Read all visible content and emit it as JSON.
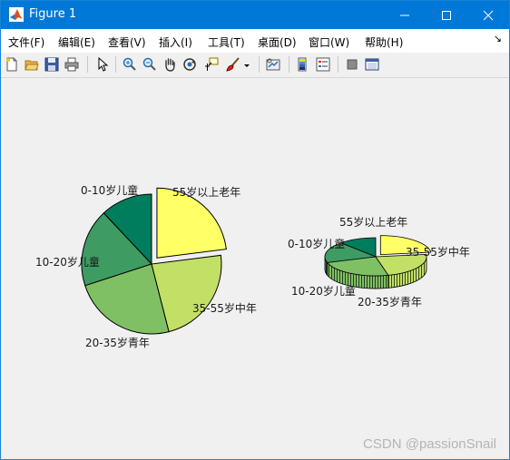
{
  "window": {
    "title": "Figure 1",
    "colors": {
      "titlebar": "#0078d7",
      "canvas": "#f0f0f0"
    }
  },
  "menubar": {
    "items": [
      "文件(F)",
      "编辑(E)",
      "查看(V)",
      "插入(I)",
      "工具(T)",
      "桌面(D)",
      "窗口(W)",
      "帮助(H)"
    ],
    "overflow_icon": "chevron-icon"
  },
  "toolbar": {
    "icons": [
      "new-figure-icon",
      "open-file-icon",
      "save-icon",
      "print-icon",
      "pointer-icon",
      "zoom-in-icon",
      "zoom-out-icon",
      "pan-hand-icon",
      "rotate-3d-icon",
      "data-cursor-icon",
      "brush-icon",
      "brush-dropdown-icon",
      "link-plot-icon",
      "colorbar-icon",
      "legend-icon",
      "hide-plot-tools-icon",
      "show-plot-tools-icon"
    ]
  },
  "chart_data": [
    {
      "type": "pie",
      "style": "2d",
      "categories": [
        "0-10岁儿童",
        "10-20岁儿童",
        "20-35岁青年",
        "35-55岁中年",
        "55岁以上老年"
      ],
      "values": [
        12,
        18,
        24,
        23,
        23
      ],
      "exploded": [
        "55岁以上老年"
      ],
      "colors": [
        "#007d5c",
        "#3e9c63",
        "#80c064",
        "#c2e066",
        "#ffff66"
      ]
    },
    {
      "type": "pie",
      "style": "3d",
      "categories": [
        "0-10岁儿童",
        "10-20岁儿童",
        "20-35岁青年",
        "35-55岁中年",
        "55岁以上老年"
      ],
      "values": [
        12,
        18,
        24,
        23,
        23
      ],
      "exploded": [
        "55岁以上老年"
      ],
      "colors": [
        "#007d5c",
        "#3e9c63",
        "#80c064",
        "#c2e066",
        "#ffff66"
      ]
    }
  ],
  "watermark": "CSDN @passionSnail"
}
